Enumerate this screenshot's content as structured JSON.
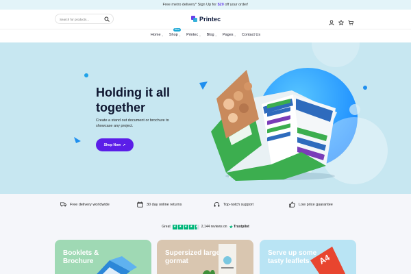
{
  "topbar": {
    "prefix": "Free metro delivery* Sign Up for ",
    "highlight": "$20",
    "suffix": " off your order!"
  },
  "header": {
    "search_placeholder": "Search for products...",
    "logo_text": "Printec",
    "icons": [
      "user-icon",
      "star-icon",
      "cart-icon"
    ]
  },
  "nav": {
    "items": [
      {
        "label": "Home",
        "has_dropdown": true
      },
      {
        "label": "Shop",
        "has_dropdown": true,
        "badge": "New"
      },
      {
        "label": "Printec",
        "has_dropdown": true
      },
      {
        "label": "Blog",
        "has_dropdown": true
      },
      {
        "label": "Pages",
        "has_dropdown": true
      },
      {
        "label": "Contact Us",
        "has_dropdown": false
      }
    ]
  },
  "hero": {
    "title": "Holding it all together",
    "subtitle": "Create a stand out document or brochure to showcase any project.",
    "cta_label": "Shop Now",
    "brochure": {
      "cover_title": "Platinum Dental Package",
      "inner_title": "Platinum Dental Package"
    }
  },
  "features": [
    {
      "icon": "truck-icon",
      "label": "Free delivery worldwide"
    },
    {
      "icon": "calendar-icon",
      "label": "30 day online returns"
    },
    {
      "icon": "headset-icon",
      "label": "Top-notch support"
    },
    {
      "icon": "thumbs-up-icon",
      "label": "Low price guarantee"
    }
  ],
  "rating": {
    "word": "Great",
    "stars": 4.5,
    "reviews": "2,144 reviews on",
    "brand": "Trustpilot"
  },
  "cards": [
    {
      "title": "Booklets & Brochure",
      "color": "#9fd9b4"
    },
    {
      "title": "Supersized large gormat",
      "color": "#d9c6b0"
    },
    {
      "title": "Serve up some tasty leaflets",
      "color": "#b9e4f4"
    }
  ],
  "colors": {
    "accent": "#5b1ee8",
    "hero_bg": "#c7e7f1",
    "circle_blue": "#1e8fff",
    "trustpilot_green": "#00b67a"
  }
}
